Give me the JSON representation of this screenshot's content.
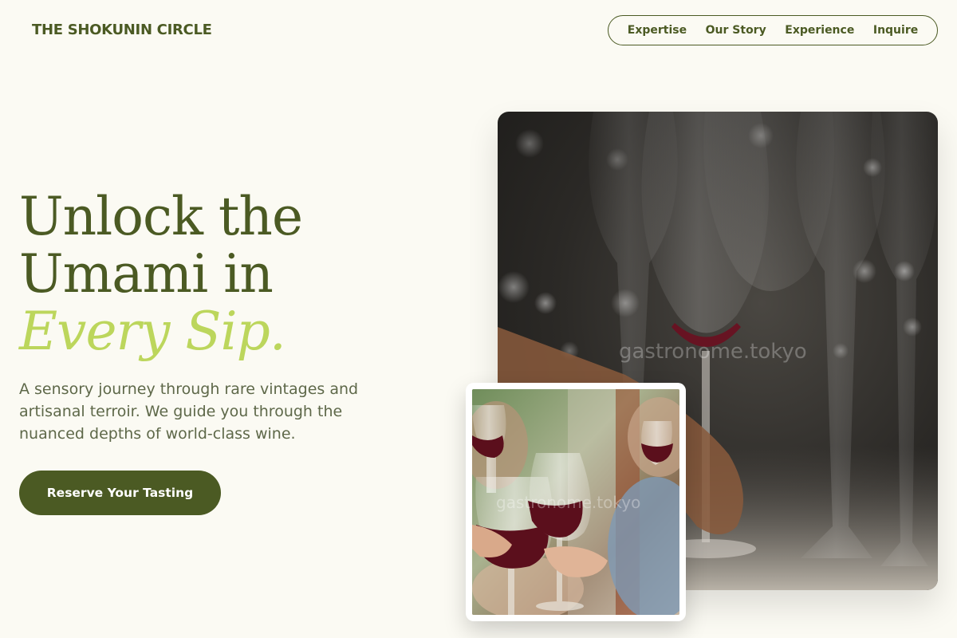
{
  "header": {
    "logo": "THE SHOKUNIN CIRCLE",
    "nav": [
      {
        "label": "Expertise"
      },
      {
        "label": "Our Story"
      },
      {
        "label": "Experience"
      },
      {
        "label": "Inquire"
      }
    ]
  },
  "hero": {
    "title_line1": "Unlock the",
    "title_line2": "Umami in",
    "title_accent": "Every Sip.",
    "subtitle": "A sensory journey through rare vintages and artisanal terroir. We guide you through the nuanced depths of world-class wine.",
    "cta_label": "Reserve Your Tasting"
  },
  "images": {
    "main_watermark": "gastronome.tokyo",
    "inset_watermark": "gastronome.tokyo"
  },
  "colors": {
    "brand": "#4b5a23",
    "accent": "#bcd65c",
    "background": "#fbfaf3"
  }
}
